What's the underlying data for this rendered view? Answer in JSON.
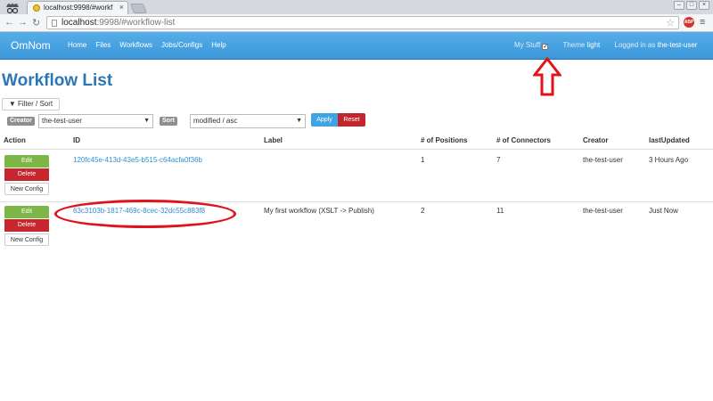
{
  "browser": {
    "tab_title": "localhost:9998/#workf",
    "tab_close": "×",
    "url_host": "localhost",
    "url_path": ":9998/#workflow-list",
    "window_buttons": [
      "–",
      "□",
      "×"
    ],
    "extension_label": "ABP"
  },
  "navbar": {
    "brand": "OmNom",
    "links": [
      "Home",
      "Files",
      "Workflows",
      "Jobs/Configs",
      "Help"
    ],
    "my_stuff_label": "My Stuff",
    "my_stuff_checked": true,
    "theme_label": "Theme",
    "theme_value": "light",
    "logged_in_label": "Logged in as",
    "user": "the-test-user"
  },
  "page": {
    "title": "Workflow List",
    "filter_button": "Filter / Sort",
    "filter": {
      "creator_label": "Creator",
      "creator_value": "the-test-user",
      "sort_label": "Sort",
      "sort_value": "modified / asc",
      "apply": "Apply",
      "reset": "Reset"
    }
  },
  "table": {
    "columns": [
      "Action",
      "ID",
      "Label",
      "# of Positions",
      "# of Connectors",
      "Creator",
      "lastUpdated"
    ],
    "action_buttons": {
      "edit": "Edit",
      "delete": "Delete",
      "config": "New Config"
    },
    "rows": [
      {
        "id": "120fc45e-413d-43e5-b515-c64acfa0f36b",
        "label": "",
        "positions": "1",
        "connectors": "7",
        "creator": "the-test-user",
        "updated": "3 Hours Ago"
      },
      {
        "id": "63c3103b-1817-469c-8cec-32dc55c883f8",
        "label": "My first workflow (XSLT -> Publish)",
        "positions": "2",
        "connectors": "11",
        "creator": "the-test-user",
        "updated": "Just Now"
      }
    ]
  },
  "annotations": {
    "color": "#e0121a"
  }
}
